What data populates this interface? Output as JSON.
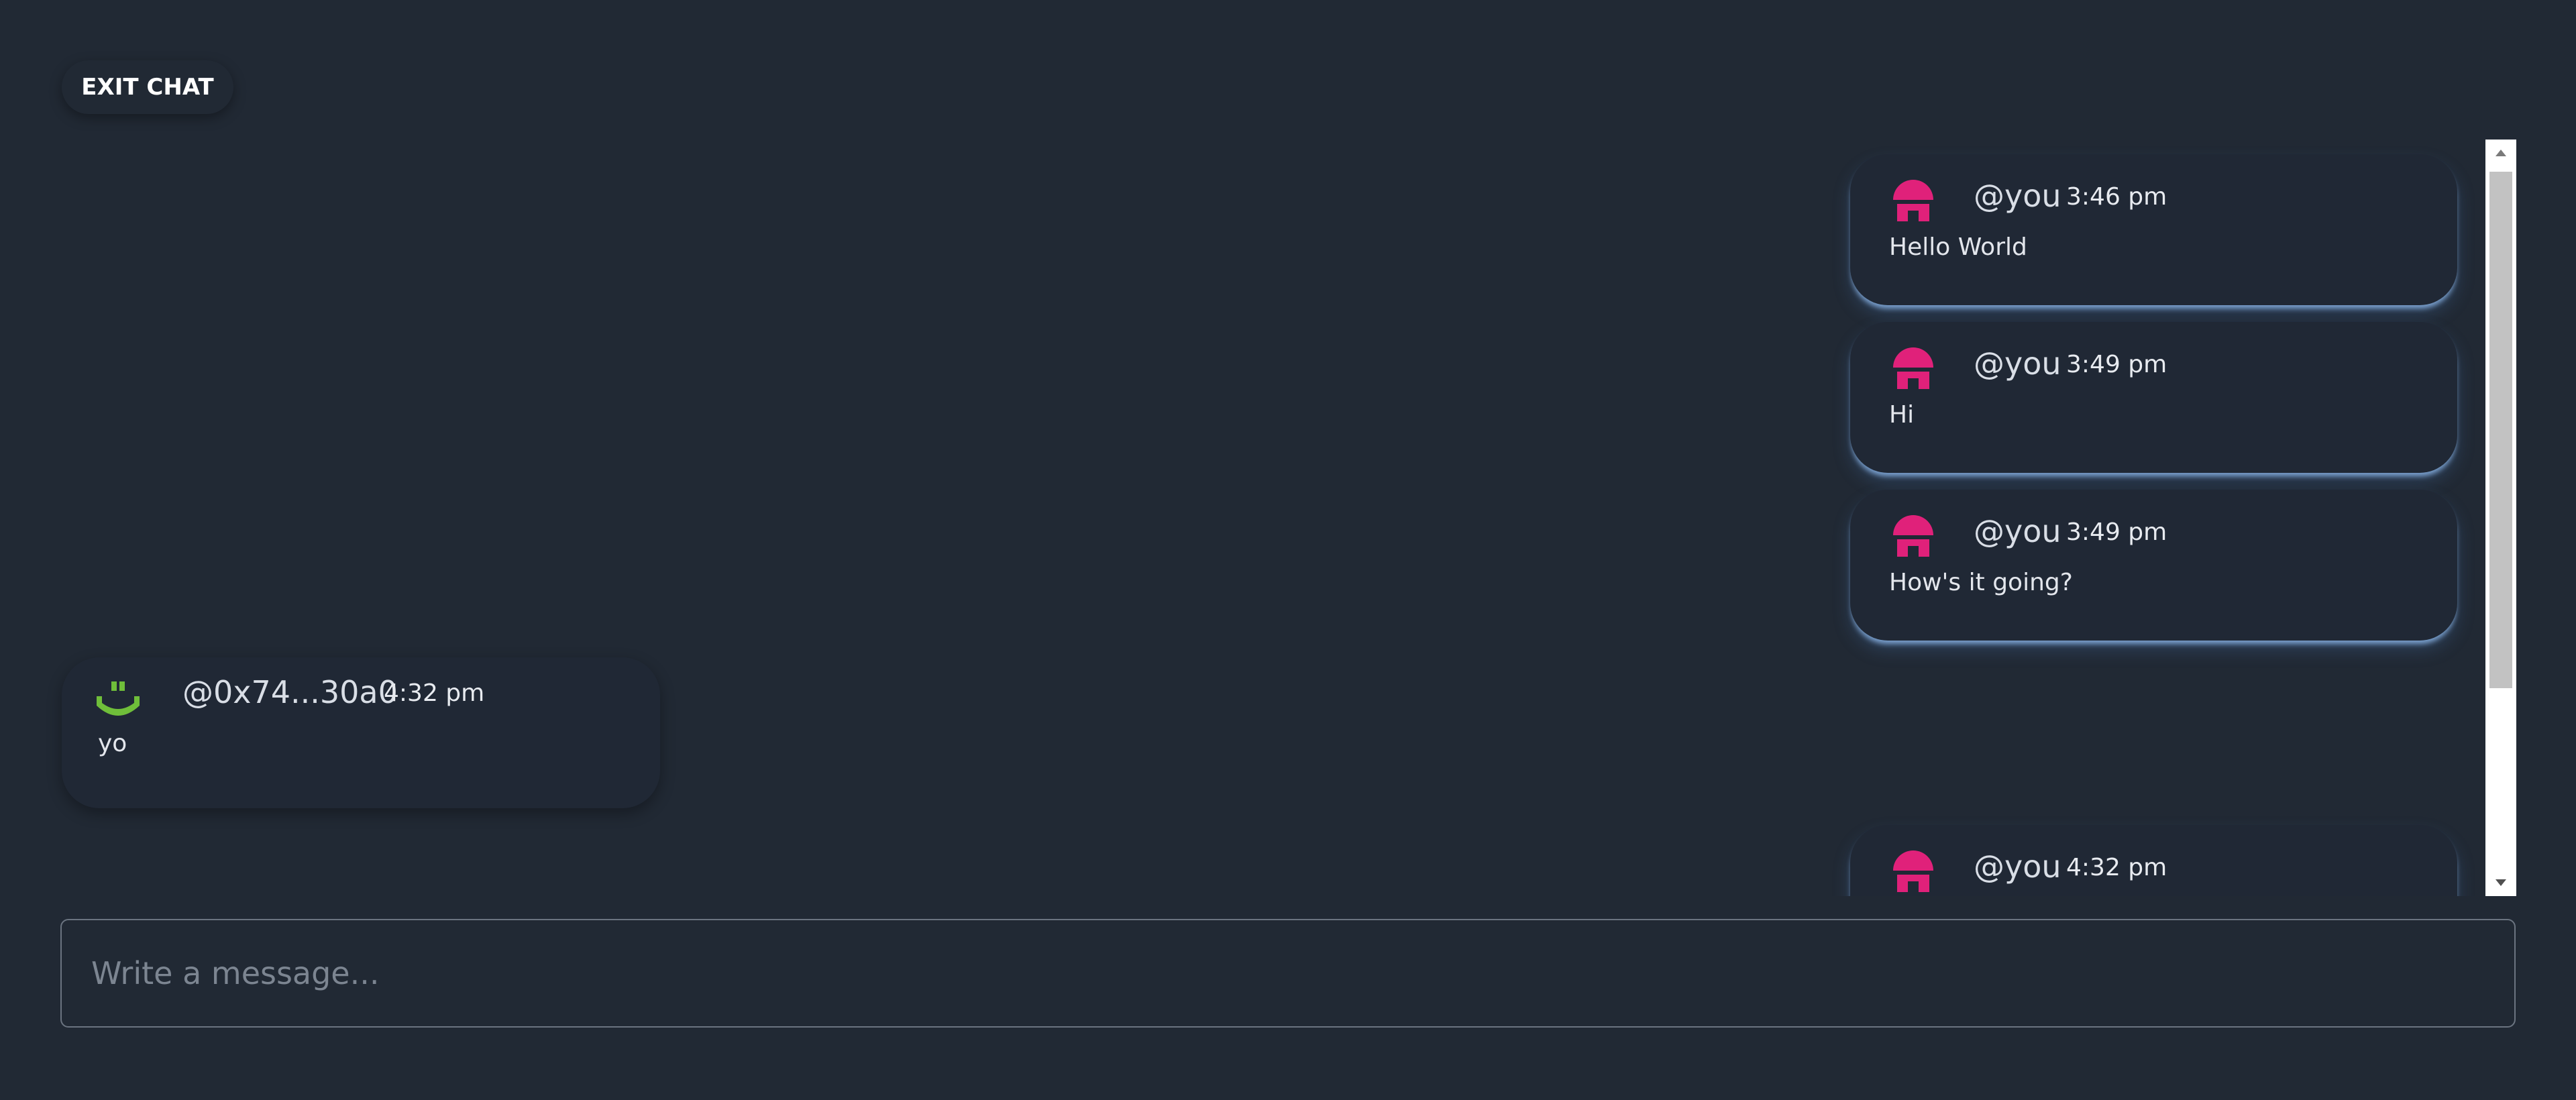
{
  "header": {
    "exit_label": "EXIT CHAT"
  },
  "colors": {
    "background": "#212934",
    "self_avatar": "#e0217a",
    "other_avatar": "#6fbe3a",
    "bubble_glow": "#8ab4e6"
  },
  "messages": [
    {
      "handle": "@you",
      "time": "3:46 pm",
      "text": "Hello World",
      "avatar_icon": "pink-dome-avatar-icon",
      "side": "right"
    },
    {
      "handle": "@you",
      "time": "3:49 pm",
      "text": "Hi",
      "avatar_icon": "pink-dome-avatar-icon",
      "side": "right"
    },
    {
      "handle": "@you",
      "time": "3:49 pm",
      "text": "How's it going?",
      "avatar_icon": "pink-dome-avatar-icon",
      "side": "right"
    },
    {
      "handle": "@0x74...30a0",
      "time": "4:32 pm",
      "text": "yo",
      "avatar_icon": "green-smiley-avatar-icon",
      "side": "left"
    },
    {
      "handle": "@you",
      "time": "4:32 pm",
      "text": "",
      "avatar_icon": "pink-dome-avatar-icon",
      "side": "right"
    }
  ],
  "composer": {
    "placeholder": "Write a message..."
  },
  "scrollbar": {
    "scroll_fraction": 0.0
  }
}
